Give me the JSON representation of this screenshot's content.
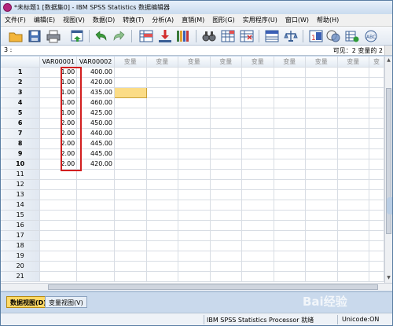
{
  "window": {
    "title": "*未标题1 [数据集0] - IBM SPSS Statistics 数据编辑器"
  },
  "menu": {
    "items": [
      "文件(F)",
      "编辑(E)",
      "视图(V)",
      "数据(D)",
      "转换(T)",
      "分析(A)",
      "直销(M)",
      "图形(G)",
      "实用程序(U)",
      "窗口(W)",
      "帮助(H)"
    ]
  },
  "toolbar": {
    "icons": [
      "open-folder-icon",
      "save-icon",
      "print-icon",
      "dialog-recall-icon",
      "undo-icon",
      "redo-icon",
      "goto-case-icon",
      "goto-variable-icon",
      "variables-icon",
      "find-icon",
      "insert-cases-icon",
      "insert-variable-icon",
      "split-file-icon",
      "weight-cases-icon",
      "select-cases-icon",
      "value-labels-icon",
      "use-sets-icon"
    ]
  },
  "refbar": {
    "cell_ref": "3 :",
    "visible_count": "可见：2 变量的 2"
  },
  "grid": {
    "columns": [
      "VAR00001",
      "VAR00002",
      "变量",
      "变量",
      "变量",
      "变量",
      "变量",
      "变量",
      "变量",
      "变量",
      "变"
    ],
    "rows": [
      {
        "n": "1",
        "var1": "1.00",
        "var2": "400.00"
      },
      {
        "n": "2",
        "var1": "1.00",
        "var2": "420.00"
      },
      {
        "n": "3",
        "var1": "1.00",
        "var2": "435.00"
      },
      {
        "n": "4",
        "var1": "1.00",
        "var2": "460.00"
      },
      {
        "n": "5",
        "var1": "1.00",
        "var2": "425.00"
      },
      {
        "n": "6",
        "var1": "2.00",
        "var2": "450.00"
      },
      {
        "n": "7",
        "var1": "2.00",
        "var2": "440.00"
      },
      {
        "n": "8",
        "var1": "2.00",
        "var2": "445.00"
      },
      {
        "n": "9",
        "var1": "2.00",
        "var2": "445.00"
      },
      {
        "n": "10",
        "var1": "2.00",
        "var2": "420.00"
      },
      {
        "n": "11",
        "var1": "",
        "var2": ""
      },
      {
        "n": "12",
        "var1": "",
        "var2": ""
      },
      {
        "n": "13",
        "var1": "",
        "var2": ""
      },
      {
        "n": "14",
        "var1": "",
        "var2": ""
      },
      {
        "n": "15",
        "var1": "",
        "var2": ""
      },
      {
        "n": "16",
        "var1": "",
        "var2": ""
      },
      {
        "n": "17",
        "var1": "",
        "var2": ""
      },
      {
        "n": "18",
        "var1": "",
        "var2": ""
      },
      {
        "n": "19",
        "var1": "",
        "var2": ""
      },
      {
        "n": "20",
        "var1": "",
        "var2": ""
      },
      {
        "n": "21",
        "var1": "",
        "var2": ""
      }
    ]
  },
  "tabs": {
    "data_view": "数据视图(D)",
    "variable_view": "变量视图(V)"
  },
  "status": {
    "processor": "IBM SPSS Statistics Processor 就绪",
    "unicode": "Unicode:ON"
  },
  "watermark": "Bai经验",
  "colors": {
    "highlight_border": "#d21f1f",
    "selected_cell": "#fbdc86",
    "active_tab": "#ffd966"
  }
}
